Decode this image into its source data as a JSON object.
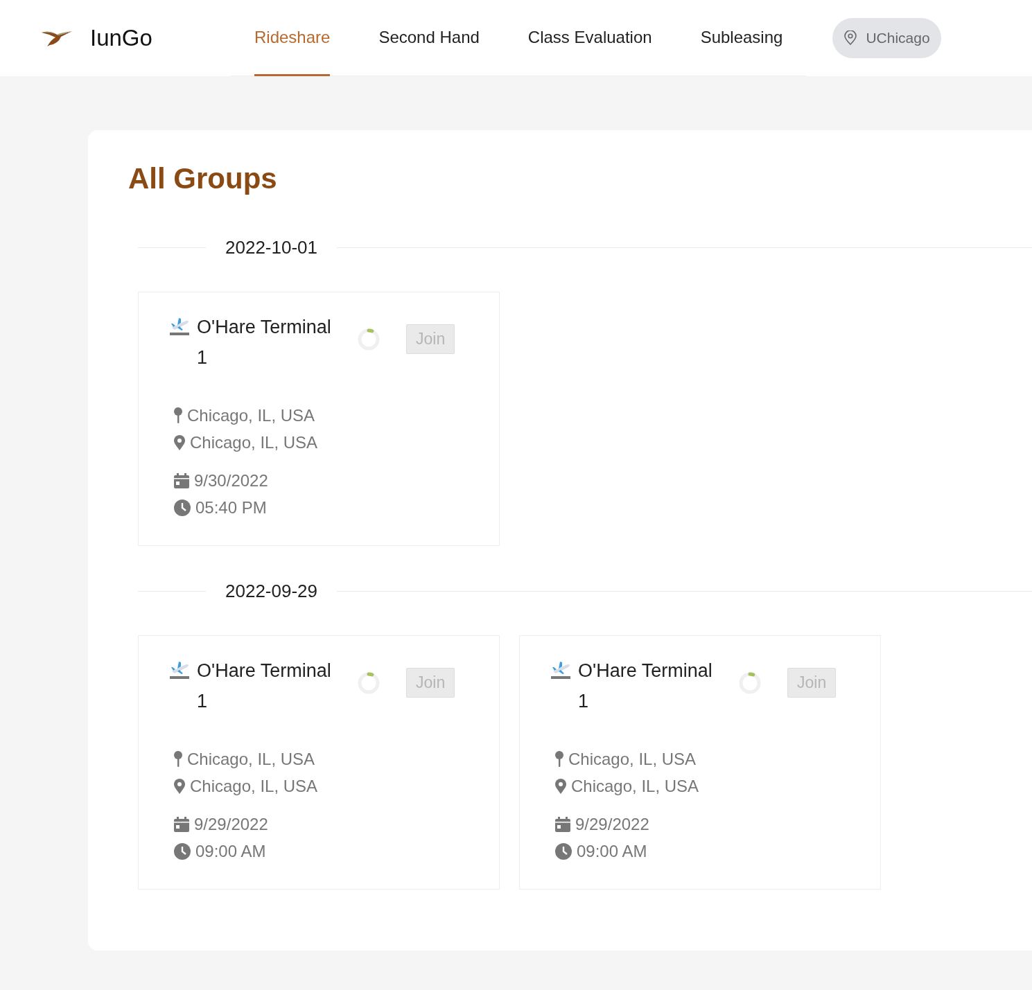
{
  "brand": {
    "name": "IunGo"
  },
  "nav": {
    "tabs": [
      {
        "label": "Rideshare",
        "selected": true
      },
      {
        "label": "Second Hand",
        "selected": false
      },
      {
        "label": "Class Evaluation",
        "selected": false
      },
      {
        "label": "Subleasing",
        "selected": false
      }
    ],
    "location_button": "UChicago"
  },
  "page": {
    "title": "All Groups",
    "date_groups": [
      {
        "date": "2022-10-01",
        "groups": [
          {
            "title": "O'Hare Terminal 1",
            "join": {
              "label": "Join",
              "disabled": true
            },
            "from": "Chicago, IL, USA",
            "to": "Chicago, IL, USA",
            "date": "9/30/2022",
            "time": "05:40 PM"
          }
        ]
      },
      {
        "date": "2022-09-29",
        "groups": [
          {
            "title": "O'Hare Terminal 1",
            "join": {
              "label": "Join",
              "disabled": true
            },
            "from": "Chicago, IL, USA",
            "to": "Chicago, IL, USA",
            "date": "9/29/2022",
            "time": "09:00 AM"
          },
          {
            "title": "O'Hare Terminal 1",
            "join": {
              "label": "Join",
              "disabled": true
            },
            "from": "Chicago, IL, USA",
            "to": "Chicago, IL, USA",
            "date": "9/29/2022",
            "time": "09:00 AM"
          }
        ]
      }
    ]
  }
}
